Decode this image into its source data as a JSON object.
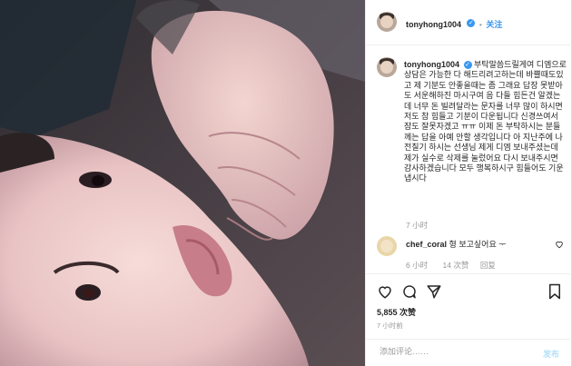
{
  "post": {
    "username": "tonyhong1004",
    "verified_mark": "✓",
    "follow_label": "关注",
    "dot": "•"
  },
  "caption": {
    "username": "tonyhong1004",
    "text": "부탁말씀드릴게여 디엠으로 상담은 가능한 다 해드리려고하는데 바쁠때도있고 제 기분도 안좋을때는 좀 그래요 답장 못받아도 서운해하진 마시구여 음 다들 힘든건 알겠는데 너무 돈 빌려달라는 문자를 너무 많이 하시면 저도 참 힘들고 기분이 다운됩니다 신경쓰여서 잠도 잘못자겠고 ㅠㅠ 이제 돈 부탁하시는 분들께는 답을 아예 안할 생각입니다 아 지난주에 나전칠기 하시는 선생님 제게 디엠 보내주셨는데 제가 실수로 삭제를 눌렀어요 다시 보내주시면 감사하겠습니다 모두 행복하시구 힘들어도 기운냅시다",
    "time": "7 小时"
  },
  "comment": {
    "username": "chef_coral",
    "text": "형 보고싶어요 ᅮ",
    "time": "6 小时",
    "likes": "14 次赞",
    "reply": "回复",
    "heart_icon": "heart-outline-icon"
  },
  "actions": {
    "icons": [
      "heart-icon",
      "comment-icon",
      "share-icon",
      "bookmark-icon"
    ],
    "likes": "5,855 次赞",
    "time_ago": "7 小时前"
  },
  "add_comment": {
    "placeholder": "添加评论……",
    "post_label": "发布"
  },
  "colors": {
    "accent": "#3897f0",
    "muted": "#999999",
    "border": "#efefef"
  }
}
